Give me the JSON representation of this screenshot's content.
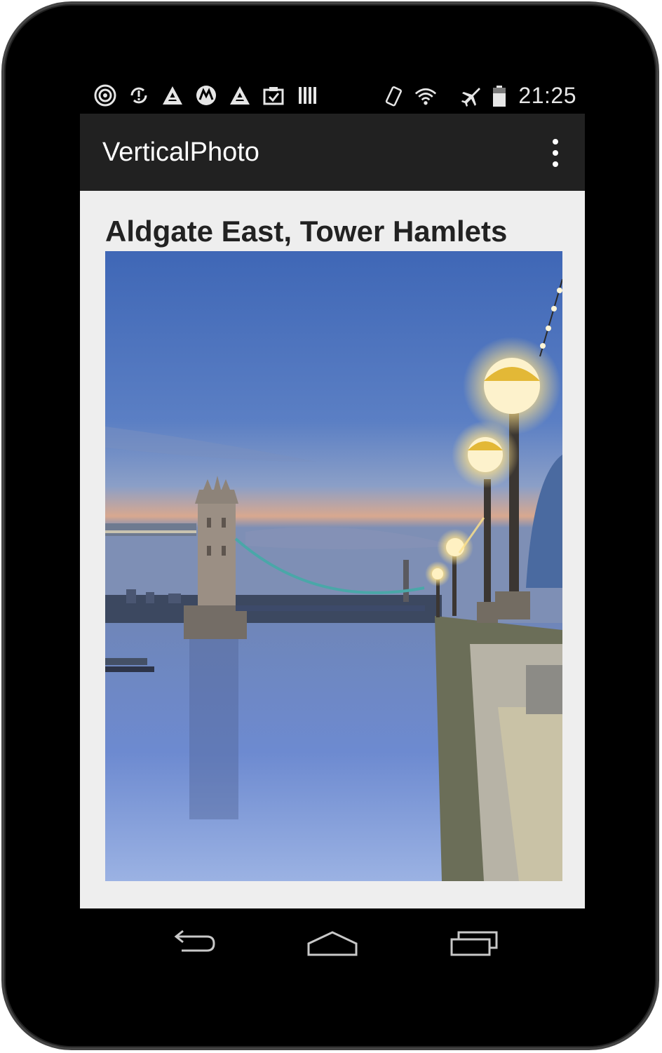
{
  "status_bar": {
    "time": "21:25",
    "left_icons": [
      "target-icon",
      "sync-alert-icon",
      "triangle-logo-icon",
      "motorola-icon",
      "triangle-logo-icon",
      "clipboard-check-icon",
      "barcode-icon"
    ],
    "right_icons": [
      "vibrate-icon",
      "wifi-icon",
      "airplane-icon",
      "battery-icon"
    ]
  },
  "action_bar": {
    "title": "VerticalPhoto",
    "overflow_icon": "overflow-menu-icon"
  },
  "content": {
    "photo_title": "Aldgate East, Tower Hamlets",
    "photo_subject": "tower-bridge-photo"
  },
  "nav_bar": {
    "icons": [
      "back-icon",
      "home-icon",
      "recents-icon"
    ]
  },
  "colors": {
    "action_bar_bg": "#212121",
    "content_bg": "#eeeeee",
    "title_text": "#222222"
  }
}
